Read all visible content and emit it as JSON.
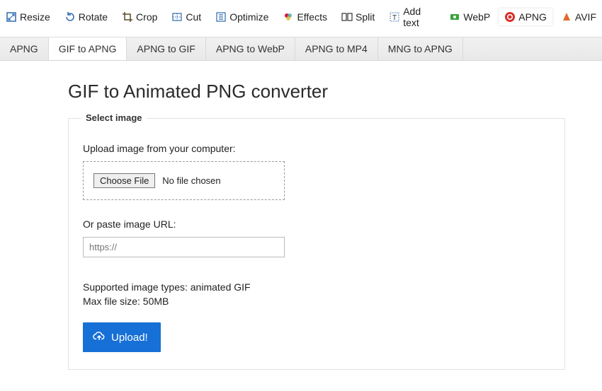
{
  "toolbar": {
    "items": [
      {
        "label": "Resize",
        "icon": "resize-icon",
        "active": false
      },
      {
        "label": "Rotate",
        "icon": "rotate-icon",
        "active": false
      },
      {
        "label": "Crop",
        "icon": "crop-icon",
        "active": false
      },
      {
        "label": "Cut",
        "icon": "cut-icon",
        "active": false
      },
      {
        "label": "Optimize",
        "icon": "optimize-icon",
        "active": false
      },
      {
        "label": "Effects",
        "icon": "effects-icon",
        "active": false
      },
      {
        "label": "Split",
        "icon": "split-icon",
        "active": false
      },
      {
        "label": "Add text",
        "icon": "add-text-icon",
        "active": false
      },
      {
        "label": "WebP",
        "icon": "webp-icon",
        "active": false
      },
      {
        "label": "APNG",
        "icon": "apng-icon",
        "active": true
      },
      {
        "label": "AVIF",
        "icon": "avif-icon",
        "active": false
      }
    ]
  },
  "subnav": {
    "tabs": [
      {
        "label": "APNG",
        "active": false
      },
      {
        "label": "GIF to APNG",
        "active": true
      },
      {
        "label": "APNG to GIF",
        "active": false
      },
      {
        "label": "APNG to WebP",
        "active": false
      },
      {
        "label": "APNG to MP4",
        "active": false
      },
      {
        "label": "MNG to APNG",
        "active": false
      }
    ]
  },
  "page": {
    "title": "GIF to Animated PNG converter"
  },
  "form": {
    "legend": "Select image",
    "upload_label": "Upload image from your computer:",
    "choose_file_label": "Choose File",
    "file_status": "No file chosen",
    "url_label": "Or paste image URL:",
    "url_placeholder": "https://",
    "supported_types": "Supported image types: animated GIF",
    "max_size": "Max file size: 50MB",
    "upload_button_label": "Upload!"
  },
  "colors": {
    "primary": "#1670d6",
    "apng_red": "#d6302a"
  }
}
